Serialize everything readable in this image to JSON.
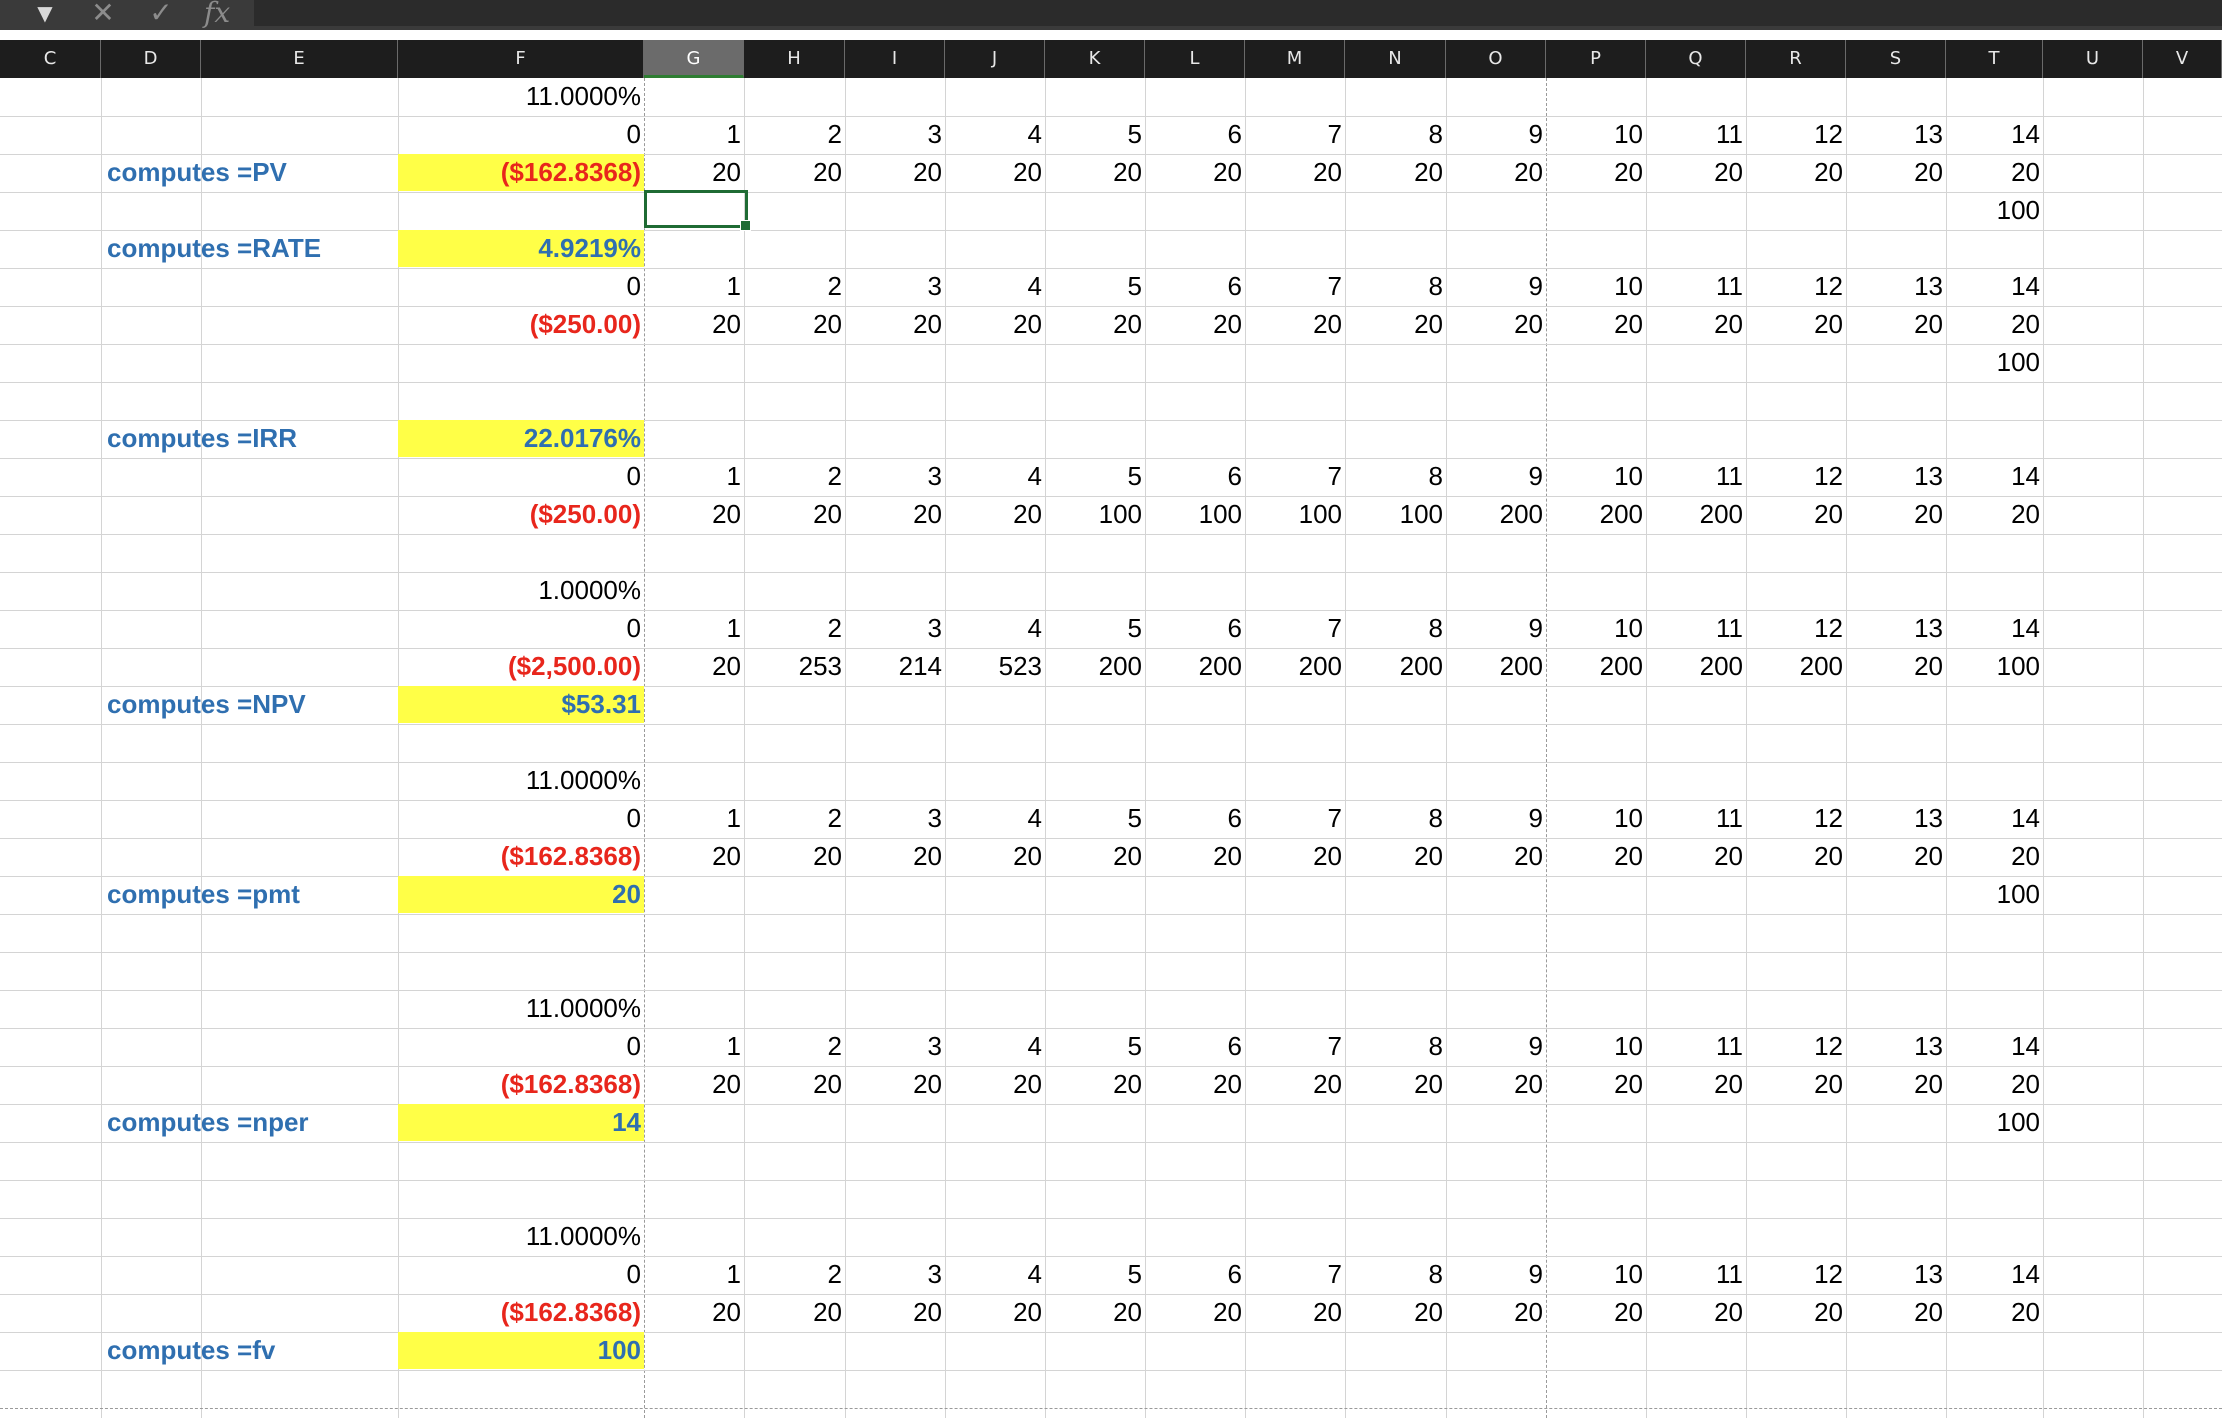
{
  "formula_bar": {
    "dropdown_icon": "chevron-down-icon",
    "cancel_icon": "close-icon",
    "confirm_icon": "check-icon",
    "fx_label": "fx",
    "formula": ""
  },
  "columns": [
    "C",
    "D",
    "E",
    "F",
    "G",
    "H",
    "I",
    "J",
    "K",
    "L",
    "M",
    "N",
    "O",
    "P",
    "Q",
    "R",
    "S",
    "T",
    "U",
    "V"
  ],
  "selected_column": "G",
  "selected_cell": "G4",
  "colors": {
    "highlight": "#ffff47",
    "negative": "#e8261c",
    "label": "#2f6fb0",
    "selection": "#1f6b34"
  },
  "rows": [
    {
      "r": 1,
      "F": "11.0000%"
    },
    {
      "r": 2,
      "F": "0",
      "nums": [
        "1",
        "2",
        "3",
        "4",
        "5",
        "6",
        "7",
        "8",
        "9",
        "10",
        "11",
        "12",
        "13",
        "14"
      ]
    },
    {
      "r": 3,
      "label": "computes =PV",
      "F": "($162.8368)",
      "F_style": "neg hl",
      "nums": [
        "20",
        "20",
        "20",
        "20",
        "20",
        "20",
        "20",
        "20",
        "20",
        "20",
        "20",
        "20",
        "20",
        "20"
      ]
    },
    {
      "r": 4,
      "T": "100"
    },
    {
      "r": 5,
      "label": "computes =RATE",
      "F": "4.9219%",
      "F_style": "blue hl"
    },
    {
      "r": 6,
      "F": "0",
      "nums": [
        "1",
        "2",
        "3",
        "4",
        "5",
        "6",
        "7",
        "8",
        "9",
        "10",
        "11",
        "12",
        "13",
        "14"
      ]
    },
    {
      "r": 7,
      "F": "($250.00)",
      "F_style": "neg",
      "nums": [
        "20",
        "20",
        "20",
        "20",
        "20",
        "20",
        "20",
        "20",
        "20",
        "20",
        "20",
        "20",
        "20",
        "20"
      ]
    },
    {
      "r": 8,
      "T": "100"
    },
    {
      "r": 9
    },
    {
      "r": 10,
      "label": "computes =IRR",
      "F": "22.0176%",
      "F_style": "blue hl"
    },
    {
      "r": 11,
      "F": "0",
      "nums": [
        "1",
        "2",
        "3",
        "4",
        "5",
        "6",
        "7",
        "8",
        "9",
        "10",
        "11",
        "12",
        "13",
        "14"
      ]
    },
    {
      "r": 12,
      "F": "($250.00)",
      "F_style": "neg",
      "nums": [
        "20",
        "20",
        "20",
        "20",
        "100",
        "100",
        "100",
        "100",
        "200",
        "200",
        "200",
        "20",
        "20",
        "20"
      ]
    },
    {
      "r": 13
    },
    {
      "r": 14,
      "F": "1.0000%"
    },
    {
      "r": 15,
      "F": "0",
      "nums": [
        "1",
        "2",
        "3",
        "4",
        "5",
        "6",
        "7",
        "8",
        "9",
        "10",
        "11",
        "12",
        "13",
        "14"
      ]
    },
    {
      "r": 16,
      "F": "($2,500.00)",
      "F_style": "neg",
      "nums": [
        "20",
        "253",
        "214",
        "523",
        "200",
        "200",
        "200",
        "200",
        "200",
        "200",
        "200",
        "200",
        "20",
        "100"
      ]
    },
    {
      "r": 17,
      "label": "computes =NPV",
      "F": "$53.31",
      "F_style": "blue hl"
    },
    {
      "r": 18
    },
    {
      "r": 19,
      "F": "11.0000%"
    },
    {
      "r": 20,
      "F": "0",
      "nums": [
        "1",
        "2",
        "3",
        "4",
        "5",
        "6",
        "7",
        "8",
        "9",
        "10",
        "11",
        "12",
        "13",
        "14"
      ]
    },
    {
      "r": 21,
      "F": "($162.8368)",
      "F_style": "neg",
      "nums": [
        "20",
        "20",
        "20",
        "20",
        "20",
        "20",
        "20",
        "20",
        "20",
        "20",
        "20",
        "20",
        "20",
        "20"
      ]
    },
    {
      "r": 22,
      "label": "computes =pmt",
      "F": "20",
      "F_style": "blue hl",
      "T": "100"
    },
    {
      "r": 23
    },
    {
      "r": 24
    },
    {
      "r": 25,
      "F": "11.0000%"
    },
    {
      "r": 26,
      "F": "0",
      "nums": [
        "1",
        "2",
        "3",
        "4",
        "5",
        "6",
        "7",
        "8",
        "9",
        "10",
        "11",
        "12",
        "13",
        "14"
      ]
    },
    {
      "r": 27,
      "F": "($162.8368)",
      "F_style": "neg",
      "nums": [
        "20",
        "20",
        "20",
        "20",
        "20",
        "20",
        "20",
        "20",
        "20",
        "20",
        "20",
        "20",
        "20",
        "20"
      ]
    },
    {
      "r": 28,
      "label": "computes =nper",
      "F": "14",
      "F_style": "blue hl",
      "T": "100"
    },
    {
      "r": 29
    },
    {
      "r": 30
    },
    {
      "r": 31,
      "F": "11.0000%"
    },
    {
      "r": 32,
      "F": "0",
      "nums": [
        "1",
        "2",
        "3",
        "4",
        "5",
        "6",
        "7",
        "8",
        "9",
        "10",
        "11",
        "12",
        "13",
        "14"
      ]
    },
    {
      "r": 33,
      "F": "($162.8368)",
      "F_style": "neg",
      "nums": [
        "20",
        "20",
        "20",
        "20",
        "20",
        "20",
        "20",
        "20",
        "20",
        "20",
        "20",
        "20",
        "20",
        "20"
      ]
    },
    {
      "r": 34,
      "label": "computes =fv",
      "F": "100",
      "F_style": "blue hl"
    },
    {
      "r": 35
    }
  ]
}
